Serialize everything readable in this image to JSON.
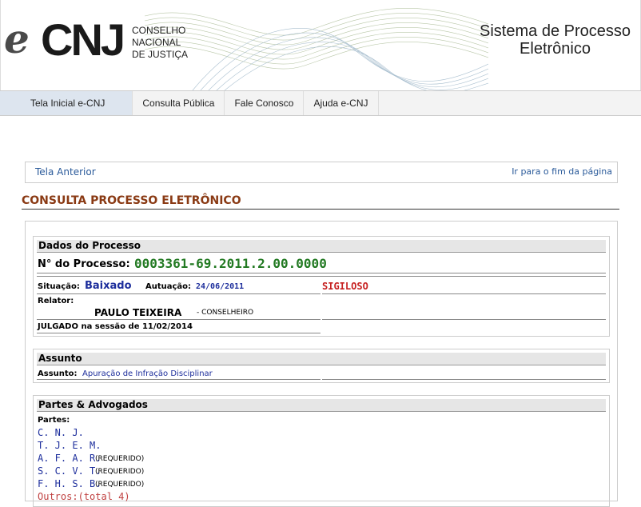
{
  "header": {
    "logo_e": "e",
    "logo_cnj": "CNJ",
    "org_line1": "CONSELHO",
    "org_line2": "NACIONAL",
    "org_line3": "DE JUSTIÇA",
    "system_line1": "Sistema de Processo",
    "system_line2": "Eletrônico"
  },
  "nav": {
    "tabs": [
      {
        "label": "Tela Inicial e-CNJ"
      },
      {
        "label": "Consulta Pública"
      },
      {
        "label": "Fale Conosco"
      },
      {
        "label": "Ajuda e-CNJ"
      }
    ]
  },
  "toolbar": {
    "back_label": "Tela Anterior",
    "end_label": "Ir para o fim da página"
  },
  "page_title": "CONSULTA PROCESSO ELETRÔNICO",
  "dados": {
    "heading": "Dados do Processo",
    "numero_label": "N° do Processo:",
    "numero_value": "0003361-69.2011.2.00.0000",
    "situacao_label": "Situação:",
    "situacao_value": "Baixado",
    "autuacao_label": "Autuação:",
    "autuacao_value": "24/06/2011",
    "sigilo": "SIGILOSO",
    "relator_label": "Relator:",
    "relator_name": "PAULO TEIXEIRA",
    "relator_role": " - CONSELHEIRO",
    "julgado": "JULGADO na sessão de 11/02/2014"
  },
  "assunto": {
    "heading": "Assunto",
    "label": "Assunto:",
    "value": "Apuração de Infração Disciplinar"
  },
  "partes": {
    "heading": "Partes & Advogados",
    "label": "Partes:",
    "items": [
      {
        "name": "C. N. J.",
        "role": ""
      },
      {
        "name": "T. J. E. M.",
        "role": ""
      },
      {
        "name": "A. F. A. R.",
        "role": "(REQUERIDO)"
      },
      {
        "name": "S. C. V. T.",
        "role": "(REQUERIDO)"
      },
      {
        "name": "F. H. S. B.",
        "role": "(REQUERIDO)"
      }
    ],
    "outros": "Outros:(total 4)"
  },
  "colors": {
    "title": "#8a3a14",
    "link_blue": "#1d2e9c",
    "process_green": "#237a23",
    "sigilo_red": "#c62020"
  }
}
